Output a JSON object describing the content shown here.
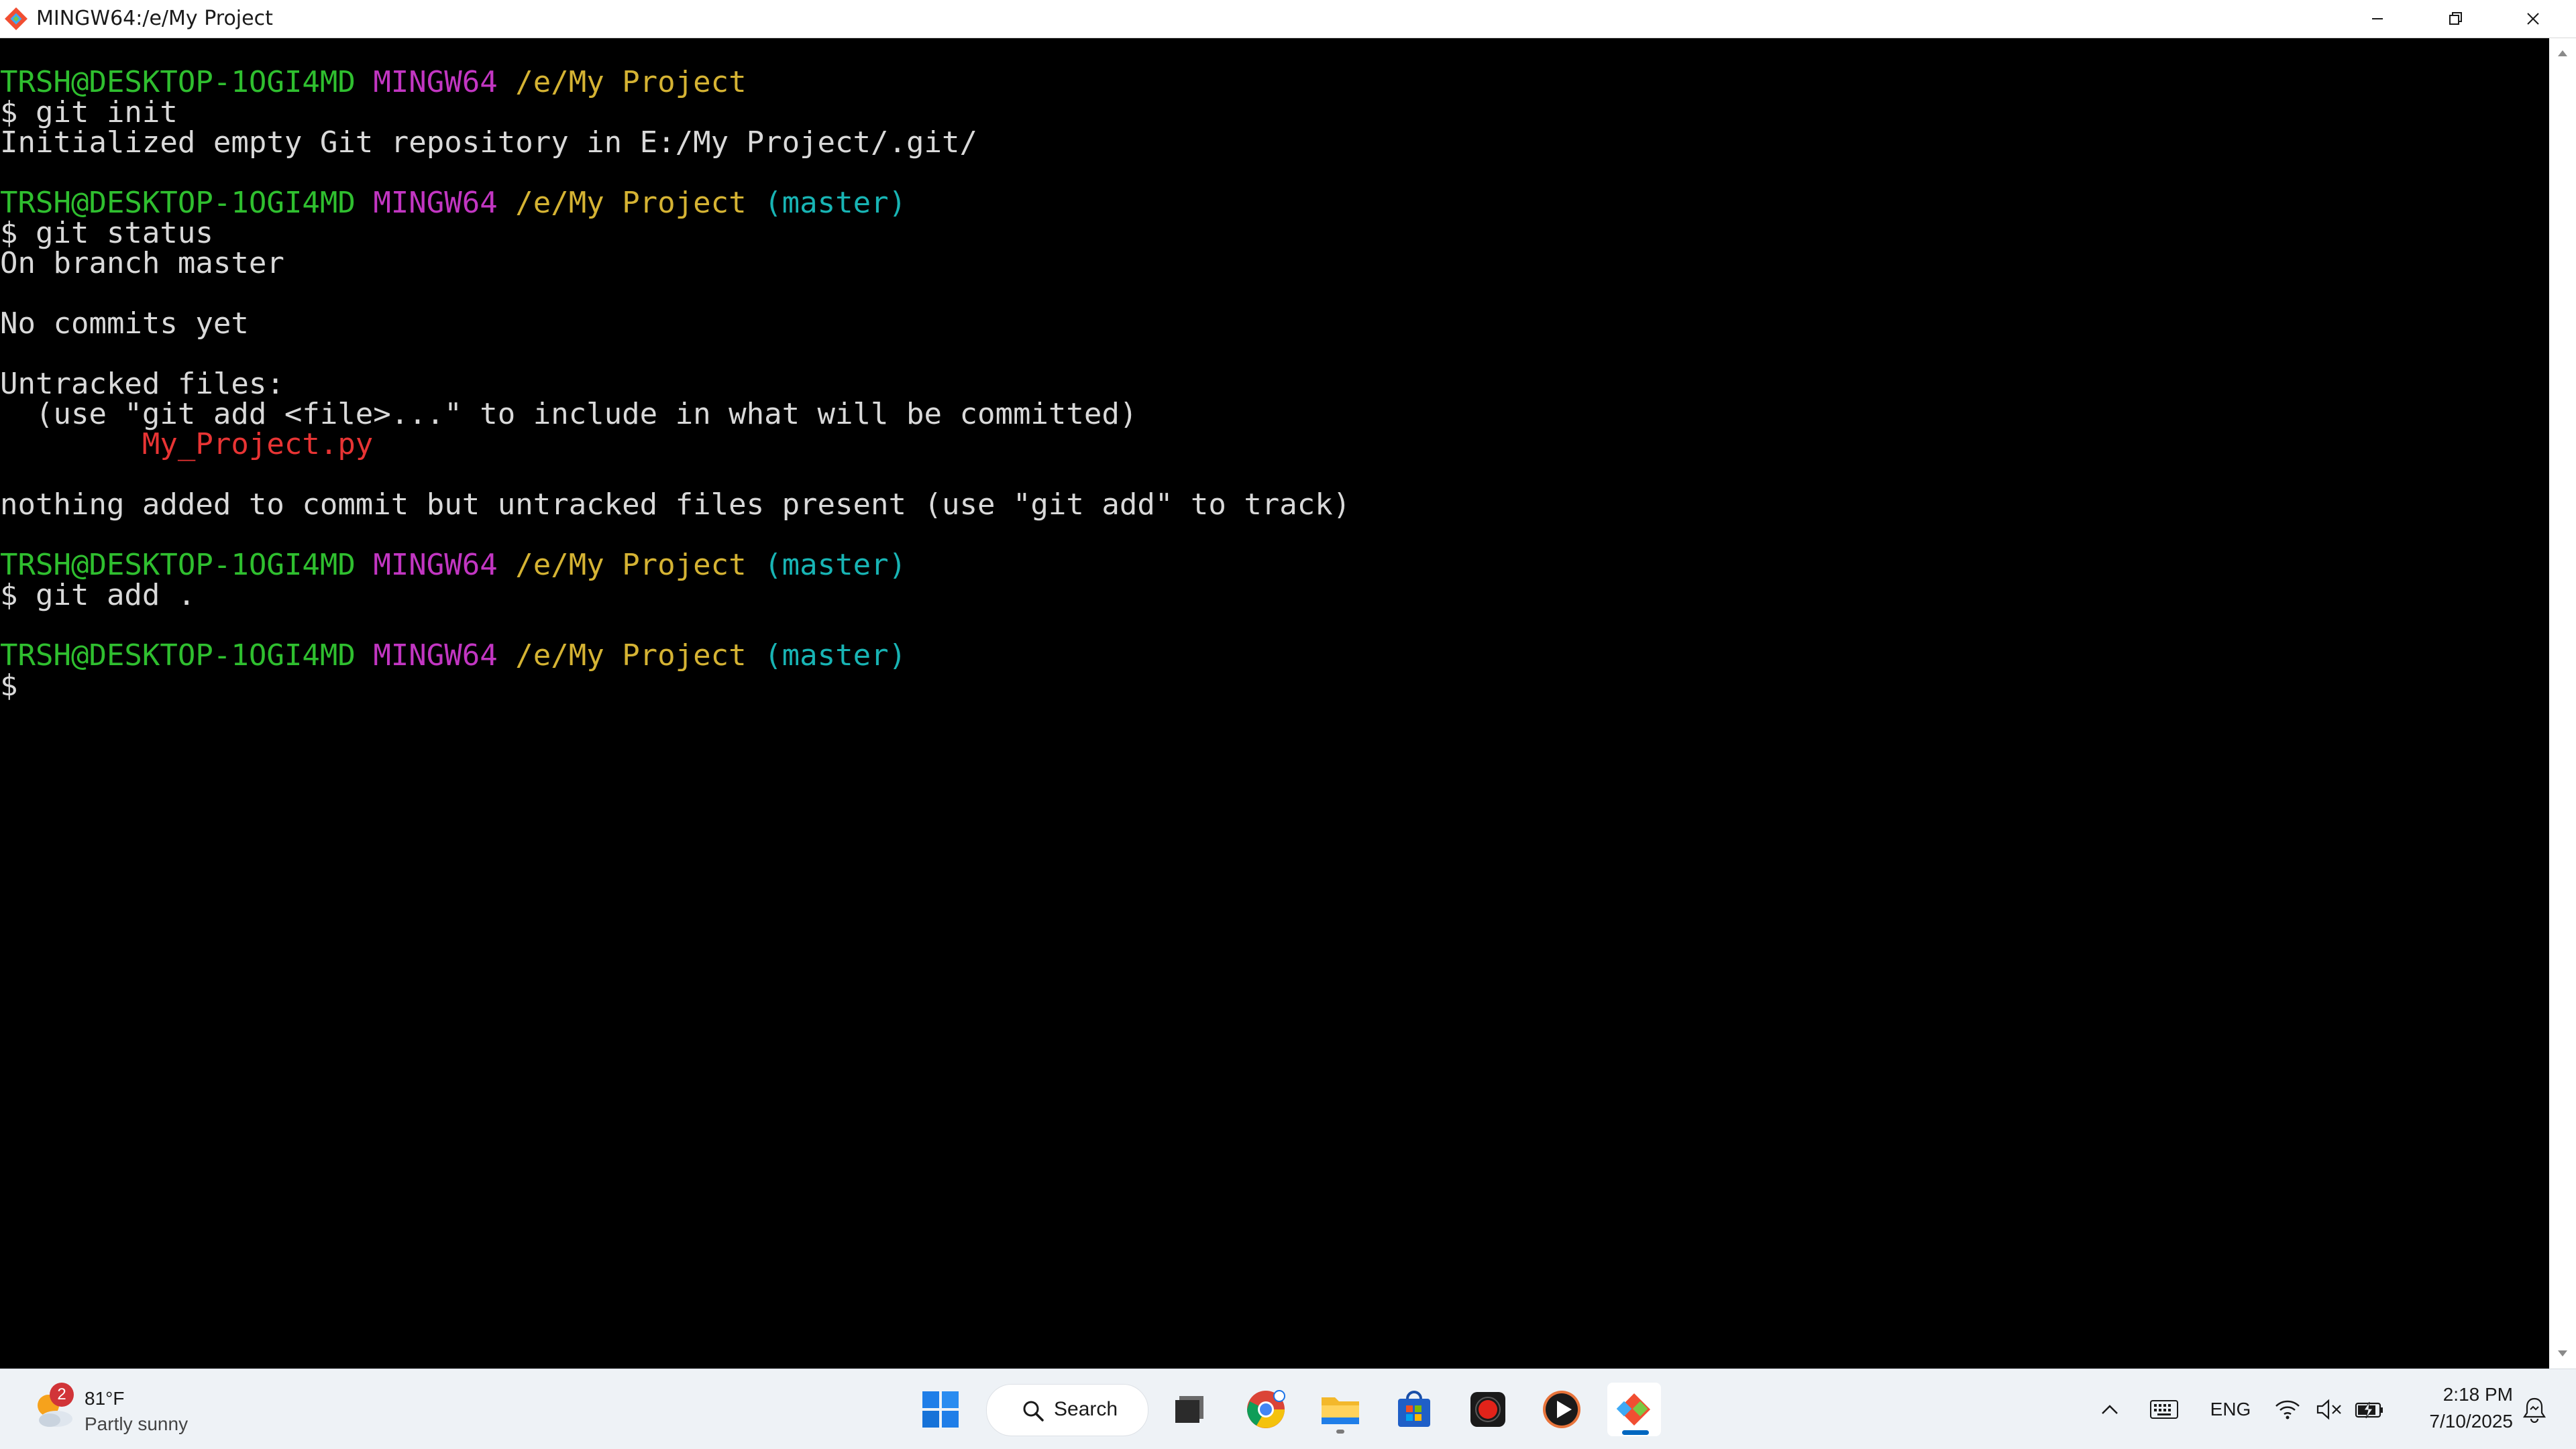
{
  "window": {
    "title": "MINGW64:/e/My Project"
  },
  "terminal": {
    "lines": [
      [
        {
          "t": "TRSH@DESKTOP-1OGI4MD",
          "c": "user"
        },
        {
          "t": " ",
          "c": "plain"
        },
        {
          "t": "MINGW64",
          "c": "mingw"
        },
        {
          "t": " ",
          "c": "plain"
        },
        {
          "t": "/e/My Project",
          "c": "path"
        }
      ],
      [
        {
          "t": "$ git init",
          "c": "plain"
        }
      ],
      [
        {
          "t": "Initialized empty Git repository in E:/My Project/.git/",
          "c": "plain"
        }
      ],
      [],
      [
        {
          "t": "TRSH@DESKTOP-1OGI4MD",
          "c": "user"
        },
        {
          "t": " ",
          "c": "plain"
        },
        {
          "t": "MINGW64",
          "c": "mingw"
        },
        {
          "t": " ",
          "c": "plain"
        },
        {
          "t": "/e/My Project",
          "c": "path"
        },
        {
          "t": " ",
          "c": "plain"
        },
        {
          "t": "(master)",
          "c": "branch"
        }
      ],
      [
        {
          "t": "$ git status",
          "c": "plain"
        }
      ],
      [
        {
          "t": "On branch master",
          "c": "plain"
        }
      ],
      [],
      [
        {
          "t": "No commits yet",
          "c": "plain"
        }
      ],
      [],
      [
        {
          "t": "Untracked files:",
          "c": "plain"
        }
      ],
      [
        {
          "t": "  (use \"git add <file>...\" to include in what will be committed)",
          "c": "plain"
        }
      ],
      [
        {
          "t": "        ",
          "c": "plain"
        },
        {
          "t": "My_Project.py",
          "c": "red"
        }
      ],
      [],
      [
        {
          "t": "nothing added to commit but untracked files present (use \"git add\" to track)",
          "c": "plain"
        }
      ],
      [],
      [
        {
          "t": "TRSH@DESKTOP-1OGI4MD",
          "c": "user"
        },
        {
          "t": " ",
          "c": "plain"
        },
        {
          "t": "MINGW64",
          "c": "mingw"
        },
        {
          "t": " ",
          "c": "plain"
        },
        {
          "t": "/e/My Project",
          "c": "path"
        },
        {
          "t": " ",
          "c": "plain"
        },
        {
          "t": "(master)",
          "c": "branch"
        }
      ],
      [
        {
          "t": "$ git add .",
          "c": "plain"
        }
      ],
      [],
      [
        {
          "t": "TRSH@DESKTOP-1OGI4MD",
          "c": "user"
        },
        {
          "t": " ",
          "c": "plain"
        },
        {
          "t": "MINGW64",
          "c": "mingw"
        },
        {
          "t": " ",
          "c": "plain"
        },
        {
          "t": "/e/My Project",
          "c": "path"
        },
        {
          "t": " ",
          "c": "plain"
        },
        {
          "t": "(master)",
          "c": "branch"
        }
      ],
      [
        {
          "t": "$",
          "c": "plain"
        }
      ]
    ]
  },
  "colors": {
    "user": "#2fbf2f",
    "mingw": "#c236c2",
    "path": "#d5b333",
    "branch": "#18b4b4",
    "untracked_file": "#e83434",
    "text": "#d9d9d9",
    "background": "#000000"
  },
  "taskbar": {
    "weather": {
      "badge": "2",
      "temp": "81°F",
      "desc": "Partly sunny",
      "icon": "partly-sunny-icon"
    },
    "search_label": "Search",
    "apps": [
      {
        "name": "task-view",
        "icon": "task-view-icon"
      },
      {
        "name": "chrome",
        "icon": "chrome-icon"
      },
      {
        "name": "file-explorer",
        "icon": "folder-icon"
      },
      {
        "name": "microsoft-store",
        "icon": "store-icon"
      },
      {
        "name": "screen-recorder",
        "icon": "record-icon"
      },
      {
        "name": "media-player",
        "icon": "play-icon"
      },
      {
        "name": "git-bash",
        "icon": "git-icon"
      }
    ],
    "tray": {
      "language": "ENG",
      "time": "2:18 PM",
      "date": "7/10/2025"
    }
  }
}
